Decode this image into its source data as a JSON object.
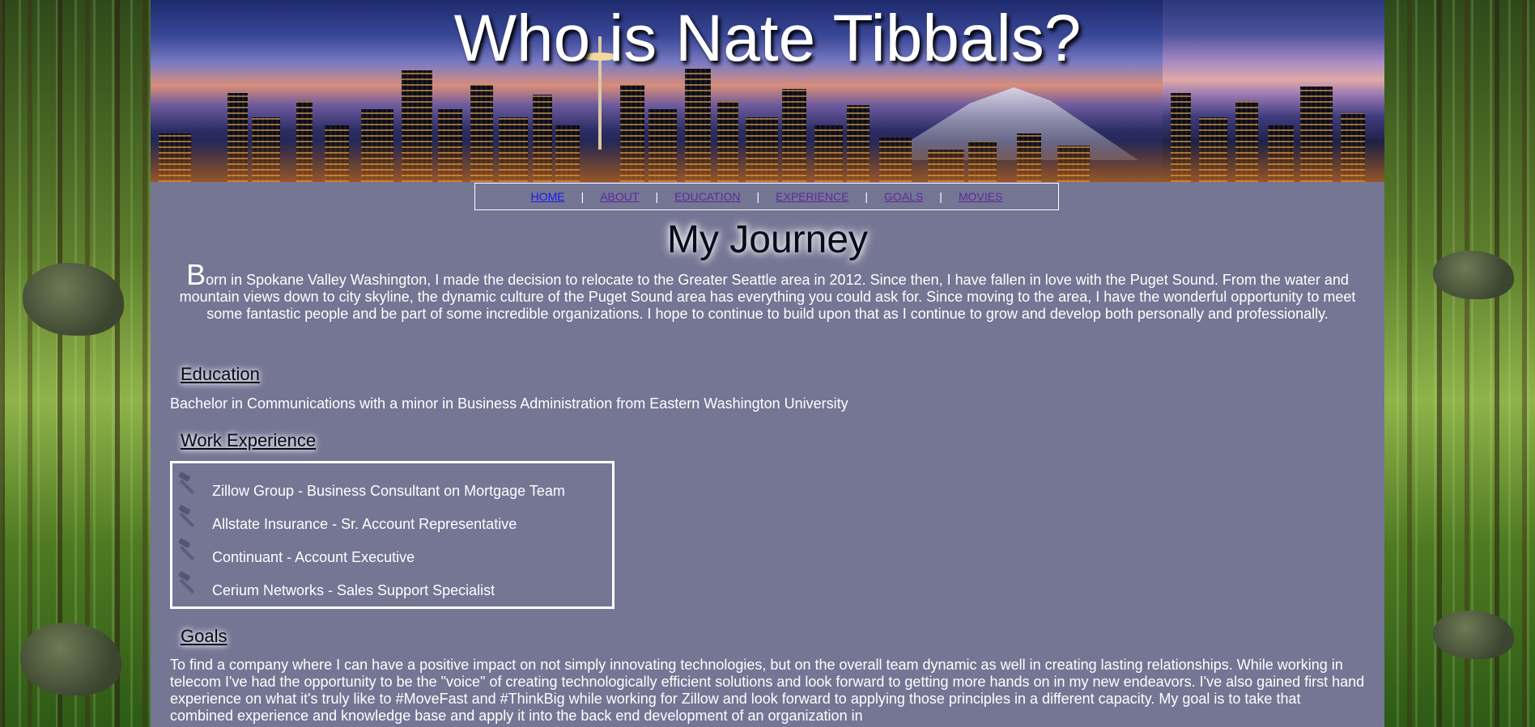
{
  "header": {
    "title": "Who is Nate Tibbals?"
  },
  "nav": {
    "items": [
      {
        "label": "HOME"
      },
      {
        "label": "ABOUT"
      },
      {
        "label": "EDUCATION"
      },
      {
        "label": "EXPERIENCE"
      },
      {
        "label": "GOALS"
      },
      {
        "label": "MOVIES"
      }
    ],
    "separator": "|"
  },
  "main": {
    "heading": "My Journey",
    "intro_dropcap": "B",
    "intro_text": "orn in Spokane Valley Washington, I made the decision to relocate to the Greater Seattle area in 2012. Since then, I have fallen in love with the Puget Sound. From the water and mountain views down to city skyline, the dynamic culture of the Puget Sound area has everything you could ask for. Since moving to the area, I have the wonderful opportunity to meet some fantastic people and be part of some incredible organizations. I hope to continue to build upon that as I continue to grow and develop both personally and professionally.",
    "education": {
      "heading": "Education",
      "text": "Bachelor in Communications with a minor in Business Administration from Eastern Washington University"
    },
    "work": {
      "heading": "Work Experience",
      "items": [
        {
          "label": "Zillow Group - Business Consultant on Mortgage Team",
          "icon": "hammer-icon"
        },
        {
          "label": "Allstate Insurance - Sr. Account Representative",
          "icon": "hammer-icon"
        },
        {
          "label": "Continuant - Account Executive",
          "icon": "hammer-icon"
        },
        {
          "label": "Cerium Networks - Sales Support Specialist",
          "icon": "hammer-icon"
        }
      ]
    },
    "goals": {
      "heading": "Goals",
      "text": "To find a company where I can have a positive impact on not simply innovating technologies, but on the overall team dynamic as well in creating lasting relationships. While working in telecom I've had the opportunity to be the \"voice\" of creating technologically efficient solutions and look forward to getting more hands on in my new endeavors. I've also gained first hand experience on what it's truly like to #MoveFast and #ThinkBig while working for Zillow and look forward to applying those principles in a different capacity. My goal is to take that combined experience and knowledge base and apply it into the back end development of an organization in"
    }
  },
  "colors": {
    "content_bg": "#757594",
    "nav_visited": "#5a2c9a",
    "nav_home": "#1a1aee",
    "text": "#ffffff"
  }
}
